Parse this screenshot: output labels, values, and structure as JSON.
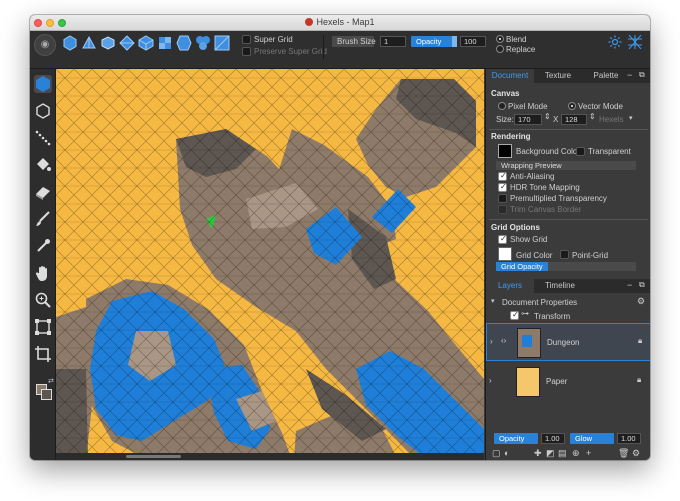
{
  "window": {
    "title": "Hexels - Map1"
  },
  "toolbar": {
    "super_grid_label": "Super Grid",
    "preserve_super_grid_label": "Preserve Super Grid",
    "brush_size_label": "Brush Size",
    "brush_size_value": "1",
    "opacity_label": "Opacity",
    "opacity_value": "100",
    "blend_label": "Blend",
    "replace_label": "Replace",
    "blend_mode": "Blend"
  },
  "tools": [
    "hexagon-fill-tool",
    "hexagon-outline-tool",
    "line-tool",
    "paint-bucket-tool",
    "eraser-tool",
    "brush-tool",
    "eyedropper-tool",
    "hand-tool",
    "zoom-tool",
    "transform-tool",
    "crop-tool"
  ],
  "document_panel": {
    "tabs": [
      "Document",
      "Texture",
      "Palette"
    ],
    "active_tab": "Document",
    "canvas": {
      "heading": "Canvas",
      "pixel_mode_label": "Pixel Mode",
      "vector_mode_label": "Vector Mode",
      "mode": "Vector Mode",
      "size_label": "Size:",
      "width": "170",
      "height": "128",
      "times": "X",
      "unit": "Hexels"
    },
    "rendering": {
      "heading": "Rendering",
      "background_color_label": "Background Color",
      "background_color": "#000000",
      "transparent_label": "Transparent",
      "wrapping_preview_label": "Wrapping Preview",
      "anti_aliasing_label": "Anti-Aliasing",
      "hdr_label": "HDR Tone Mapping",
      "premultiplied_label": "Premultiplied Transparency",
      "trim_label": "Trim Canvas Border"
    },
    "grid": {
      "heading": "Grid Options",
      "show_grid_label": "Show Grid",
      "grid_color_label": "Grid Color",
      "point_grid_label": "Point-Grid",
      "grid_opacity_label": "Grid Opacity",
      "grid_color": "#ffffff"
    }
  },
  "layers_panel": {
    "tabs": [
      "Layers",
      "Timeline"
    ],
    "active_tab": "Layers",
    "document_properties_label": "Document Properties",
    "transform_label": "Transform",
    "layers": [
      {
        "name": "Dungeon",
        "selected": true
      },
      {
        "name": "Paper",
        "selected": false
      }
    ],
    "opacity_label": "Opacity",
    "opacity_value": "1.00",
    "glow_label": "Glow",
    "glow_value": "1.00"
  },
  "colors": {
    "accent": "#2a82d8",
    "canvas_background": "#f5b842",
    "rock": "#8d7a68",
    "water": "#1f7fd8",
    "dark_rock": "#5e5650",
    "marker": "#2ecc40"
  }
}
